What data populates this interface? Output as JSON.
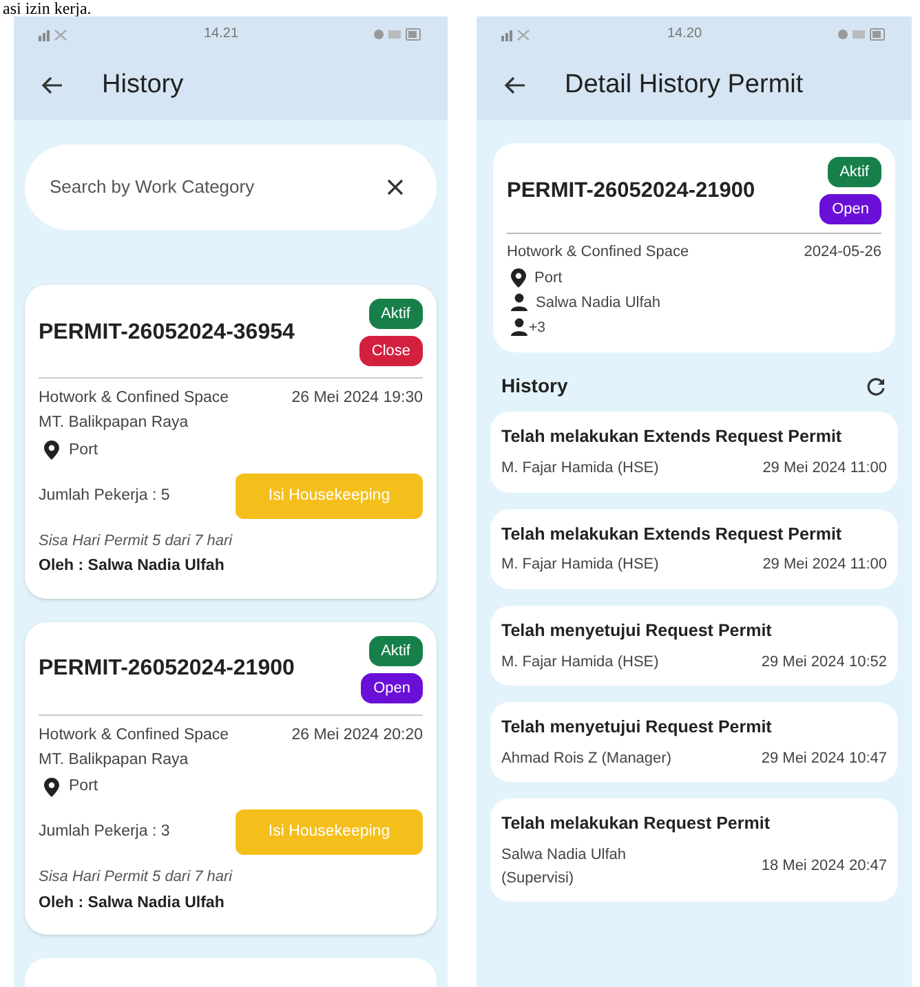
{
  "caption": "asi izin kerja.",
  "history_screen": {
    "status_bar": {
      "time": "14.21"
    },
    "title": "History",
    "search": {
      "placeholder": "Search by Work Category"
    },
    "permits": [
      {
        "id": "PERMIT-26052024-36954",
        "badges": [
          {
            "label": "Aktif",
            "color": "#17804a"
          },
          {
            "label": "Close",
            "color": "#d3203f"
          }
        ],
        "category": "Hotwork & Confined Space",
        "datetime": "26 Mei 2024 19:30",
        "vessel": "MT. Balikpapan Raya",
        "location": "Port",
        "workers": "Jumlah Pekerja : 5",
        "action": "Isi Housekeeping",
        "remaining": "Sisa Hari Permit 5 dari 7 hari",
        "by": "Oleh : Salwa Nadia Ulfah"
      },
      {
        "id": "PERMIT-26052024-21900",
        "badges": [
          {
            "label": "Aktif",
            "color": "#17804a"
          },
          {
            "label": "Open",
            "color": "#6a0fd8"
          }
        ],
        "category": "Hotwork & Confined Space",
        "datetime": "26 Mei 2024 20:20",
        "vessel": "MT. Balikpapan Raya",
        "location": "Port",
        "workers": "Jumlah Pekerja : 3",
        "action": "Isi Housekeeping",
        "remaining": "Sisa Hari Permit 5 dari 7 hari",
        "by": "Oleh : Salwa Nadia Ulfah"
      }
    ]
  },
  "detail_screen": {
    "status_bar": {
      "time": "14.20"
    },
    "title": "Detail History Permit",
    "permit": {
      "id": "PERMIT-26052024-21900",
      "badges": [
        {
          "label": "Aktif",
          "color": "#17804a"
        },
        {
          "label": "Open",
          "color": "#6a0fd8"
        }
      ],
      "category": "Hotwork & Confined Space",
      "date": "2024-05-26",
      "location": "Port",
      "person": "Salwa Nadia Ulfah",
      "extra_workers": "+3"
    },
    "history_title": "History",
    "entries": [
      {
        "action": "Telah melakukan Extends Request Permit",
        "actor": "M. Fajar Hamida (HSE)",
        "time": "29 Mei 2024 11:00"
      },
      {
        "action": "Telah melakukan Extends Request Permit",
        "actor": "M. Fajar Hamida (HSE)",
        "time": "29 Mei 2024 11:00"
      },
      {
        "action": "Telah menyetujui Request Permit",
        "actor": "M. Fajar Hamida (HSE)",
        "time": "29 Mei 2024 10:52"
      },
      {
        "action": "Telah menyetujui Request Permit",
        "actor": "Ahmad Rois Z (Manager)",
        "time": "29 Mei 2024 10:47"
      },
      {
        "action": "Telah melakukan Request Permit",
        "actor": "Salwa Nadia Ulfah (Supervisi)",
        "time": "18 Mei 2024 20:47"
      }
    ]
  }
}
